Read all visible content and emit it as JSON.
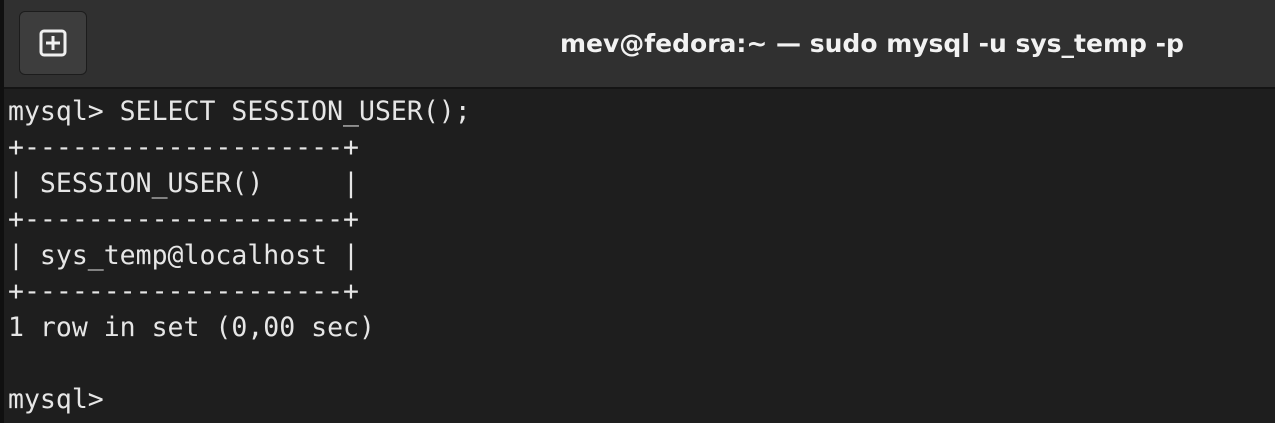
{
  "window": {
    "title": "mev@fedora:~ — sudo mysql -u sys_temp -p"
  },
  "header": {
    "new_tab_icon": "plus-square-icon"
  },
  "terminal": {
    "lines": [
      "mysql> SELECT SESSION_USER();",
      "+--------------------+",
      "| SESSION_USER()     |",
      "+--------------------+",
      "| sys_temp@localhost |",
      "+--------------------+",
      "1 row in set (0,00 sec)",
      "",
      "mysql> "
    ]
  },
  "colors": {
    "background": "#1e1e1e",
    "titlebar": "#303030",
    "text": "#e6e6e6"
  }
}
